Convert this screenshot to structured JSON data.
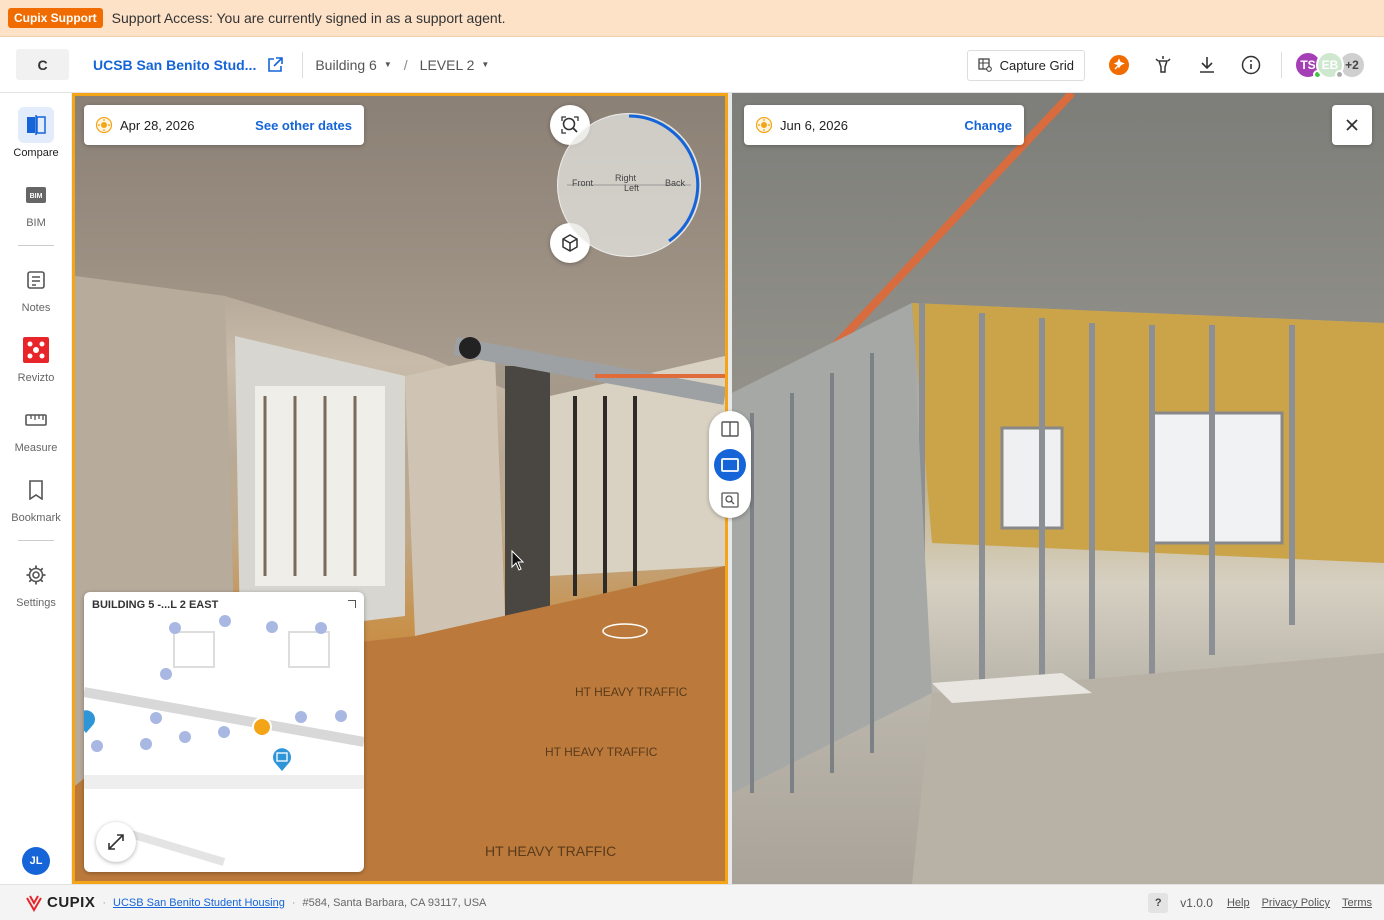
{
  "banner": {
    "badge": "Cupix Support",
    "text": "Support Access: You are currently signed in as a support agent."
  },
  "header": {
    "logo_letter": "C",
    "project_title": "UCSB San Benito Stud...",
    "building": "Building 6",
    "level": "LEVEL 2",
    "separator": "/",
    "capture_grid_label": "Capture Grid",
    "users": {
      "initials_1": "TS",
      "initials_2": "EB",
      "more": "+2"
    }
  },
  "sidebar": {
    "items": [
      {
        "label": "Compare",
        "icon": "compare-icon"
      },
      {
        "label": "BIM",
        "icon": "bim-icon"
      },
      {
        "label": "Notes",
        "icon": "notes-icon"
      },
      {
        "label": "Revizto",
        "icon": "revizto-icon"
      },
      {
        "label": "Measure",
        "icon": "measure-icon"
      },
      {
        "label": "Bookmark",
        "icon": "bookmark-icon"
      },
      {
        "label": "Settings",
        "icon": "gear-icon"
      }
    ],
    "user_initials": "JL"
  },
  "left_view": {
    "date": "Apr 28, 2026",
    "date_link": "See other dates",
    "compass": {
      "front": "Front",
      "right": "Right",
      "left": "Left",
      "back": "Back"
    },
    "minimap_title": "BUILDING 5 -...L 2 EAST"
  },
  "right_view": {
    "date": "Jun 6, 2026",
    "date_link": "Change"
  },
  "footer": {
    "brand": "CUPIX",
    "project_link": "UCSB San Benito Student Housing",
    "address": "#584, Santa Barbara, CA 93117, USA",
    "help_q": "?",
    "version": "v1.0.0",
    "help": "Help",
    "privacy": "Privacy Policy",
    "terms": "Terms"
  },
  "colors": {
    "accent": "#1565d8",
    "highlight": "#f4a417",
    "banner": "#fde2c8",
    "badge": "#f06c00"
  }
}
